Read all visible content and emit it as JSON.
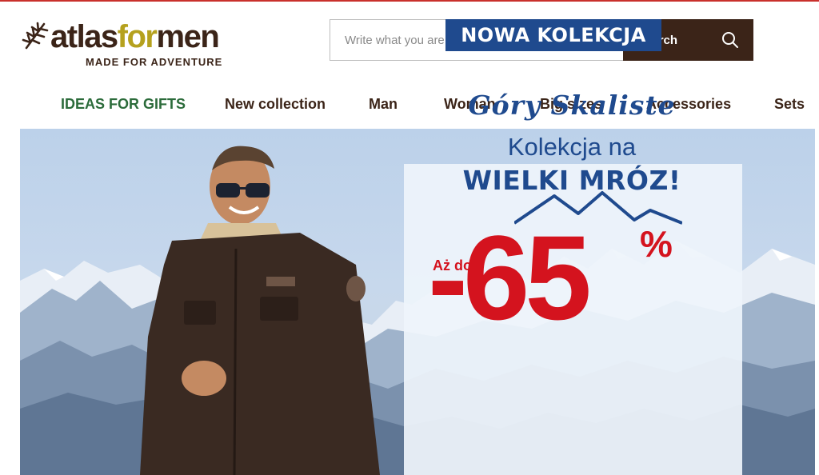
{
  "brand": {
    "name_part1": "atlas",
    "name_part2": "for",
    "name_part3": "men",
    "tagline": "MADE FOR ADVENTURE"
  },
  "search": {
    "placeholder": "Write what you are looking for, article, article code",
    "button_label": "Search"
  },
  "nav": {
    "items": [
      {
        "label": "IDEAS FOR GIFTS"
      },
      {
        "label": "New collection"
      },
      {
        "label": "Man"
      },
      {
        "label": "Woman"
      },
      {
        "label": "Big sizes"
      },
      {
        "label": "Accessories"
      },
      {
        "label": "Sets"
      }
    ]
  },
  "hero": {
    "badge": "NOWA KOLEKCJA",
    "collection_name": "Góry Skaliste",
    "line1": "Kolekcja na",
    "line2": "WIELKI MRÓZ!",
    "up_to": "Aż do",
    "discount": "-65",
    "percent": "%"
  },
  "colors": {
    "brand_brown": "#3b2418",
    "brand_olive": "#b5a11e",
    "gifts_green": "#2b6b3a",
    "promo_blue": "#1f4a8e",
    "promo_red": "#d4131e",
    "top_line_red": "#c9302c"
  }
}
